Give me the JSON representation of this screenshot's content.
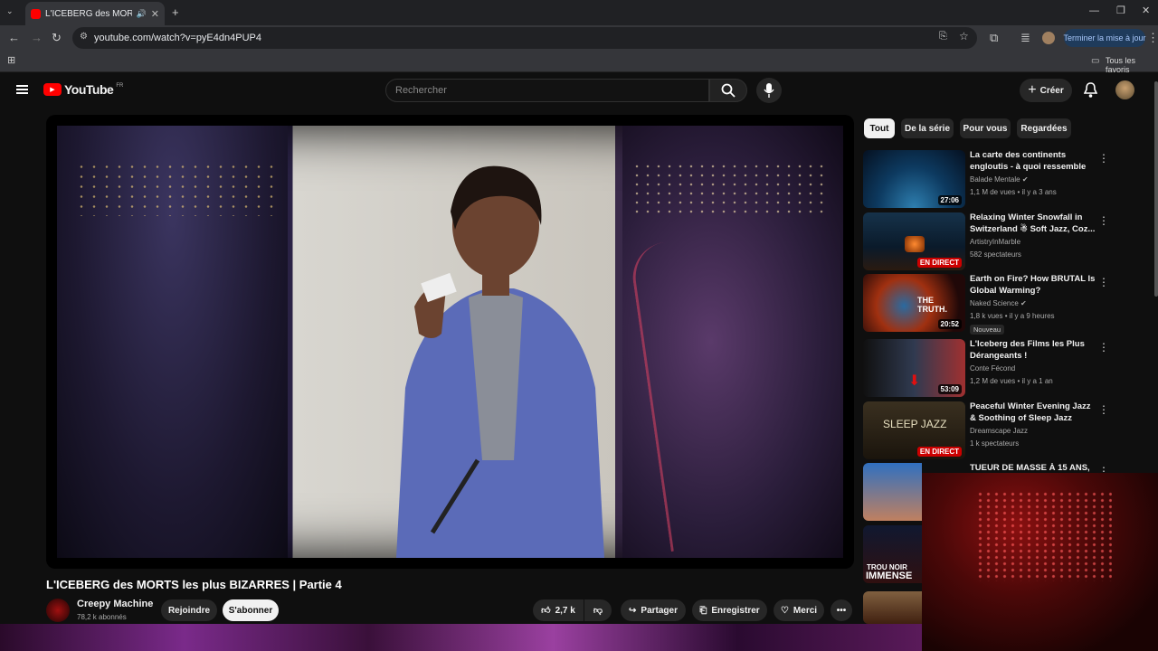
{
  "browser": {
    "tab_title": "L'ICEBERG des MORTS les p",
    "url": "youtube.com/watch?v=pyE4dn4PUP4",
    "update_label": "Terminer la mise à jour",
    "bookmarks_label": "Tous les favoris"
  },
  "header": {
    "logo": "YouTube",
    "region": "FR",
    "search_placeholder": "Rechercher",
    "create_label": "Créer"
  },
  "video": {
    "title": "L'ICEBERG des MORTS les plus BIZARRES | Partie 4",
    "channel": "Creepy Machine",
    "subscribers": "78,2 k abonnés",
    "join_label": "Rejoindre",
    "subscribe_label": "S'abonner",
    "likes": "2,7 k",
    "share_label": "Partager",
    "save_label": "Enregistrer",
    "thanks_label": "Merci"
  },
  "chips": [
    "Tout",
    "De la série",
    "Pour vous",
    "Regardées"
  ],
  "recommendations": [
    {
      "title": "La carte des continents engloutis - à quoi ressemble la...",
      "channel": "Balade Mentale",
      "meta": "1,1 M de vues • il y a 3 ans",
      "duration": "27:06",
      "verified": true
    },
    {
      "title": "Relaxing Winter Snowfall in Switzerland ☃ Soft Jazz, Coz...",
      "channel": "ArtistryInMarble",
      "meta": "582 spectateurs",
      "live": "EN DIRECT"
    },
    {
      "title": "Earth on Fire? How BRUTAL Is Global Warming?",
      "channel": "Naked Science",
      "meta": "1,8 k vues • il y a 9 heures",
      "duration": "20:52",
      "badge": "Nouveau",
      "thumb_text": "THE TRUTH.",
      "verified": true
    },
    {
      "title": "L'Iceberg des Films les Plus Dérangeants !",
      "channel": "Conte Fécond",
      "meta": "1,2 M de vues • il y a 1 an",
      "duration": "53:09"
    },
    {
      "title": "Peaceful Winter Evening Jazz & Soothing of Sleep Jazz Piano ...",
      "channel": "Dreamscape Jazz",
      "meta": "1 k spectateurs",
      "live": "EN DIRECT",
      "thumb_text": "SLEEP JAZZ"
    },
    {
      "title": "TUEUR DE MASSE À 15 ANS,",
      "channel": "",
      "meta": ""
    }
  ],
  "partial_thumbs": [
    {
      "text": "TROU NOIR"
    },
    {
      "text": "IMMENSE"
    }
  ]
}
